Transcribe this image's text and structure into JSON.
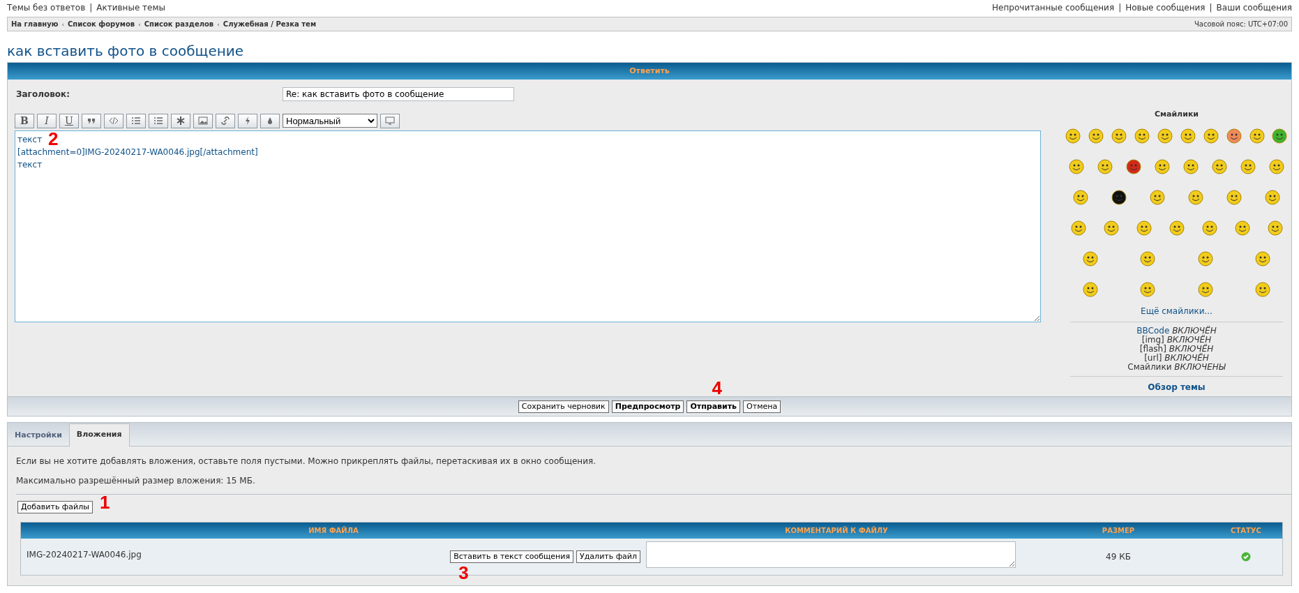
{
  "top_links": {
    "left": [
      "Темы без ответов",
      "Активные темы"
    ],
    "right": [
      "Непрочитанные сообщения",
      "Новые сообщения",
      "Ваши сообщения"
    ],
    "separator": "|"
  },
  "breadcrumb_separator": "‹",
  "breadcrumbs": [
    "На главную",
    "Список форумов",
    "Список разделов",
    "Служебная / Резка тем"
  ],
  "timezone": "Часовой пояс: UTC+07:00",
  "page_title": "как вставить фото в сообщение",
  "reply_panel": {
    "header": "Ответить",
    "subject_label": "Заголовок:",
    "subject_value": "Re: как вставить фото в сообщение",
    "format_buttons": [
      "B",
      "I",
      "U"
    ],
    "font_size": "Нормальный",
    "message_lines": [
      "текст",
      "[attachment=0]IMG-20240217-WA0046.jpg[/attachment]",
      "текст"
    ],
    "smilies": {
      "title": "Смайлики",
      "more_link": "Ещё смайлики...",
      "options": [
        {
          "name": "BBCode",
          "is_link": true,
          "state": "ВКЛЮЧЁН"
        },
        {
          "name": "[img]",
          "is_link": false,
          "state": "ВКЛЮЧЁН"
        },
        {
          "name": "[flash]",
          "is_link": false,
          "state": "ВКЛЮЧЁН"
        },
        {
          "name": "[url]",
          "is_link": false,
          "state": "ВКЛЮЧЁН"
        },
        {
          "name": "Смайлики",
          "is_link": false,
          "state": "ВКЛЮЧЕНЫ"
        }
      ],
      "topic_review": "Обзор темы"
    },
    "buttons": [
      {
        "label": "Сохранить черновик",
        "bold": false
      },
      {
        "label": "Предпросмотр",
        "bold": true
      },
      {
        "label": "Отправить",
        "bold": true
      },
      {
        "label": "Отмена",
        "bold": false
      }
    ]
  },
  "tabs": [
    {
      "label": "Настройки",
      "selected": false
    },
    {
      "label": "Вложения",
      "selected": true
    }
  ],
  "attachments": {
    "notes": [
      "Если вы не хотите добавлять вложения, оставьте поля пустыми. Можно прикреплять файлы, перетаскивая их в окно сообщения.",
      "Максимально разрешённый размер вложения: 15 МБ."
    ],
    "add_button": "Добавить файлы",
    "table": {
      "columns": [
        "ИМЯ ФАЙЛА",
        "КОММЕНТАРИЙ К ФАЙЛУ",
        "РАЗМЕР",
        "СТАТУС"
      ],
      "rows": [
        {
          "file_name": "IMG-20240217-WA0046.jpg",
          "actions": [
            "Вставить в текст сообщения",
            "Удалить файл"
          ],
          "size": "49 КБ",
          "uploaded": true
        }
      ]
    }
  },
  "annotations": [
    "2",
    "1",
    "3",
    "4"
  ]
}
